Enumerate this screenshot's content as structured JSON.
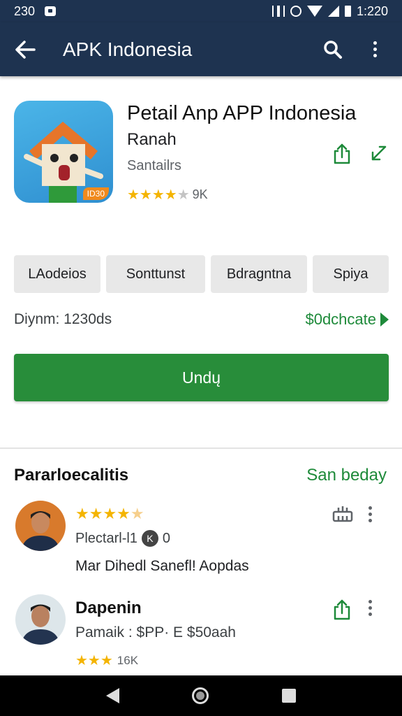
{
  "status_bar": {
    "time_left": "230",
    "time_right": "1:220"
  },
  "app_bar": {
    "title": "APK Indonesia",
    "back_icon": "arrow-left-icon",
    "search_icon": "search-icon",
    "more_icon": "more-vert-icon"
  },
  "app": {
    "name": "Petail Anp APP Indonesia",
    "developer": "Ranah",
    "category": "Santailrs",
    "rating_stars": 4,
    "rating_count": "9K",
    "icon_badge": "ID30"
  },
  "chips": [
    "LAodeios",
    "Sonttunst",
    "Bdragntna",
    "Spiya"
  ],
  "downloads": {
    "text": "Diynm: 1230ds",
    "link": "$0dchcate"
  },
  "install_button": "Undų",
  "reviews": {
    "title": "Pararloecalitis",
    "see_all": "San beday",
    "items": [
      {
        "stars": 4.5,
        "meta": "Plectarl-l1",
        "meta_badge": "K",
        "meta_value": "0",
        "text": "Mar Dihedl Sanefl! Aopdas"
      },
      {
        "name": "Dapenin",
        "sub": "Pamaik : $PP· E $50aah",
        "stars": 3,
        "count": "16K"
      }
    ]
  },
  "colors": {
    "app_bar": "#1e3350",
    "accent_green": "#288d3a",
    "link_green": "#1e8a3a",
    "star": "#f4b400"
  }
}
